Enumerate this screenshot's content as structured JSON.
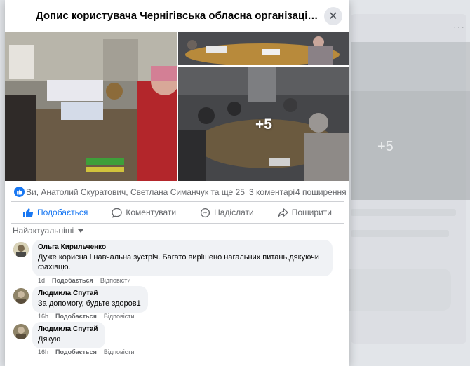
{
  "modal": {
    "title": "Допис користувача Чернігівська обласна організація ве...",
    "close_icon": "close-icon"
  },
  "photos": {
    "more_count": "+5"
  },
  "reactions": {
    "reactors": "Ви, Анатолий Скуратович, Светлана Симанчук та ще 25",
    "comments_count": "3 коментарі",
    "shares_count": "4 поширення"
  },
  "actions": {
    "like": "Подобається",
    "comment": "Коментувати",
    "send": "Надіслати",
    "share": "Поширити"
  },
  "sort_label": "Найактуальніші",
  "comments": [
    {
      "author": "Ольга Кирильченко",
      "text": "Дуже корисна і навчальна зустріч. Багато вирішено нагальних питань,дякуючи фахівцю.",
      "time": "1d",
      "like": "Подобається",
      "reply": "Відповісти"
    },
    {
      "author": "Людмила Спутай",
      "text": "За допомогу, будьте здоров1",
      "time": "16h",
      "like": "Подобається",
      "reply": "Відповісти"
    },
    {
      "author": "Людмила Спутай",
      "text": "Дякую",
      "time": "16h",
      "like": "Подобається",
      "reply": "Відповісти"
    }
  ],
  "background": {
    "more_count": "+5",
    "dots": "···"
  },
  "colors": {
    "accent": "#1877f2",
    "text": "#050505",
    "secondary": "#65676b",
    "bubble": "#f0f2f5"
  }
}
